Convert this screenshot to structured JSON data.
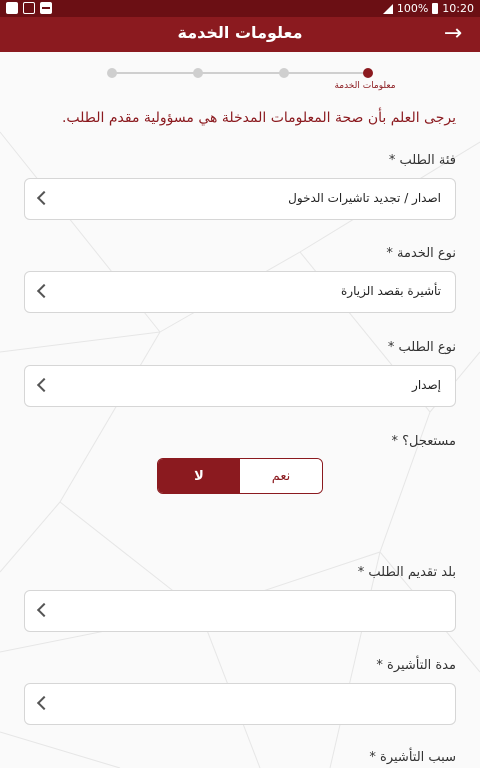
{
  "status_bar": {
    "battery": "100%",
    "time": "10:20"
  },
  "header": {
    "title": "معلومات الخدمة",
    "back_icon": "arrow-right-icon"
  },
  "stepper": {
    "active_step_label": "معلومات الخدمة"
  },
  "notice": "يرجى العلم بأن صحة المعلومات المدخلة هي مسؤولية مقدم الطلب.",
  "form": {
    "request_category": {
      "label": "فئة الطلب *",
      "value": "اصدار / تجديد تاشيرات الدخول"
    },
    "service_type": {
      "label": "نوع الخدمة *",
      "value": "تأشيرة بقصد الزيارة"
    },
    "request_type": {
      "label": "نوع الطلب *",
      "value": "إصدار"
    },
    "urgent": {
      "label": "مستعجل؟ *",
      "no": "لا",
      "yes": "نعم",
      "selected": "no"
    },
    "submit_country": {
      "label": "بلد تقديم الطلب *",
      "value": ""
    },
    "visa_duration": {
      "label": "مدة التأشيرة *",
      "value": ""
    },
    "visa_reason": {
      "label": "سبب التأشيرة *",
      "value": ""
    }
  },
  "colors": {
    "primary": "#8b1a1f",
    "status_bar": "#6b0f14",
    "field_border": "#d6d6d6",
    "background": "#fafafa"
  }
}
